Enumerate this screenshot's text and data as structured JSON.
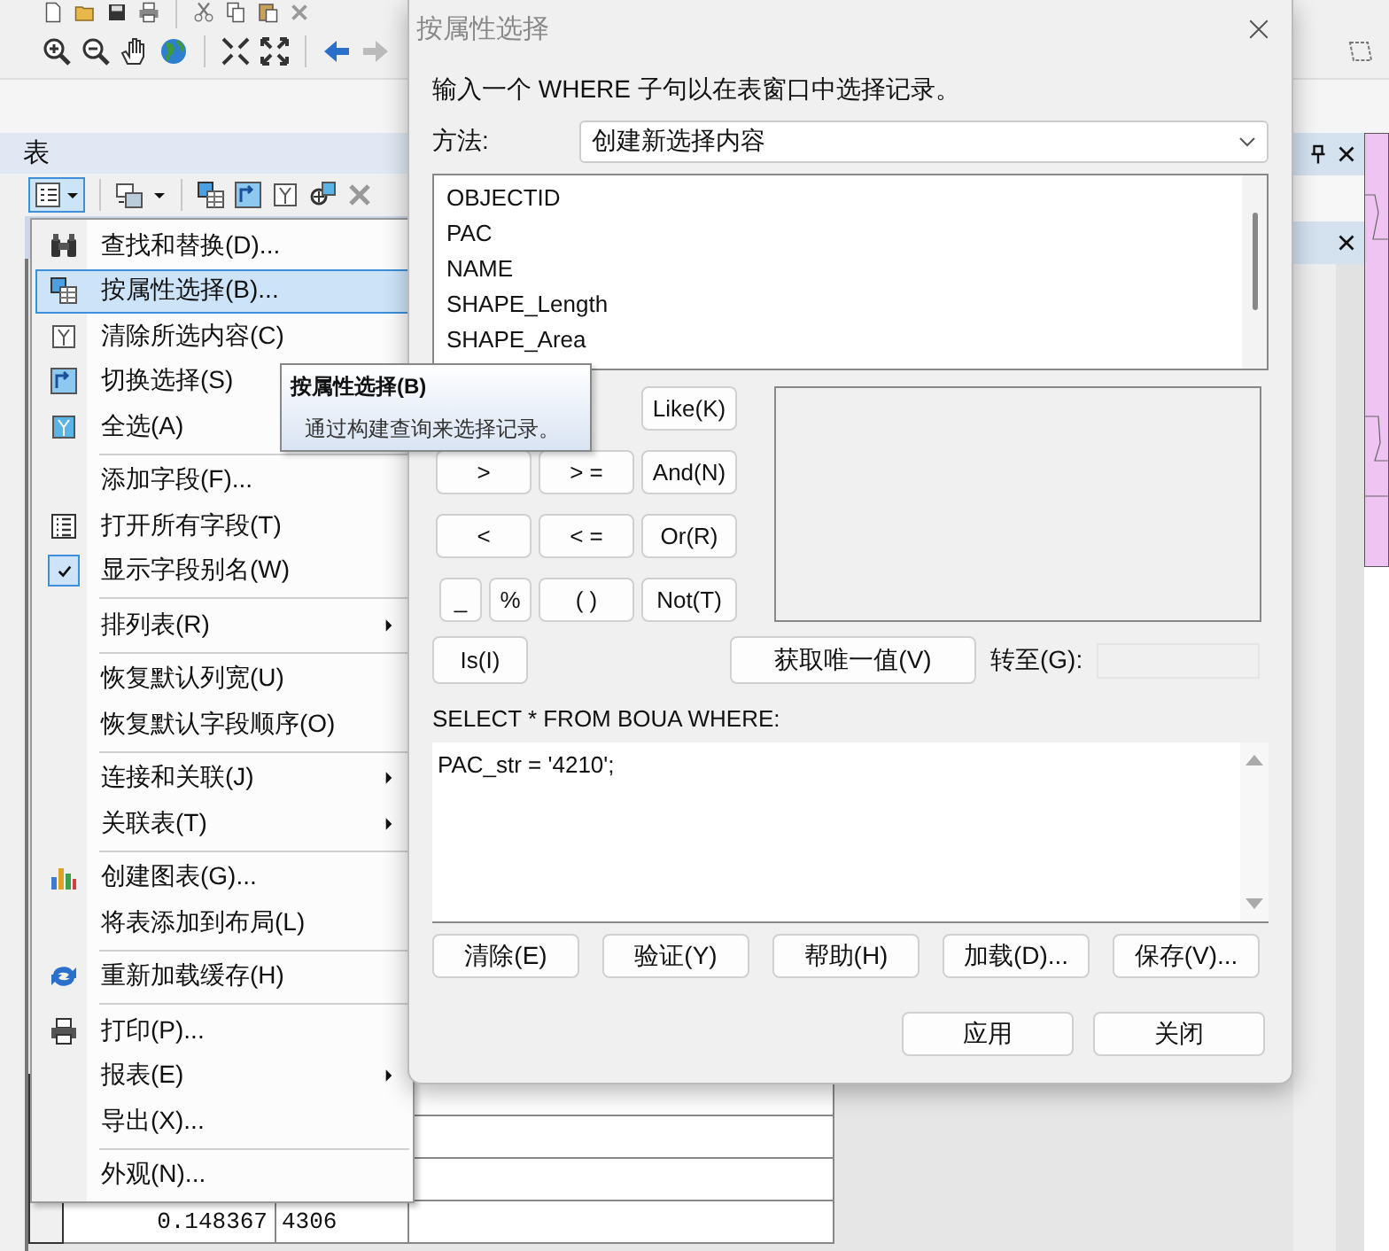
{
  "panel": {
    "title": "表"
  },
  "menu": {
    "items": [
      {
        "kind": "item",
        "label": "查找和替换(D)...",
        "selected": false,
        "checked": false,
        "submenu": false
      },
      {
        "kind": "item",
        "label": "按属性选择(B)...",
        "selected": true,
        "checked": false,
        "submenu": false
      },
      {
        "kind": "item",
        "label": "清除所选内容(C)",
        "selected": false,
        "checked": false,
        "submenu": false
      },
      {
        "kind": "item",
        "label": "切换选择(S)",
        "selected": false,
        "checked": false,
        "submenu": false
      },
      {
        "kind": "item",
        "label": "全选(A)",
        "selected": false,
        "checked": false,
        "submenu": false
      },
      {
        "kind": "separator"
      },
      {
        "kind": "item",
        "label": "添加字段(F)...",
        "selected": false,
        "checked": false,
        "submenu": false
      },
      {
        "kind": "item",
        "label": "打开所有字段(T)",
        "selected": false,
        "checked": false,
        "submenu": false
      },
      {
        "kind": "item",
        "label": "显示字段别名(W)",
        "selected": false,
        "checked": true,
        "submenu": false
      },
      {
        "kind": "separator"
      },
      {
        "kind": "item",
        "label": "排列表(R)",
        "selected": false,
        "checked": false,
        "submenu": true
      },
      {
        "kind": "separator"
      },
      {
        "kind": "item",
        "label": "恢复默认列宽(U)",
        "selected": false,
        "checked": false,
        "submenu": false
      },
      {
        "kind": "item",
        "label": "恢复默认字段顺序(O)",
        "selected": false,
        "checked": false,
        "submenu": false
      },
      {
        "kind": "separator"
      },
      {
        "kind": "item",
        "label": "连接和关联(J)",
        "selected": false,
        "checked": false,
        "submenu": true
      },
      {
        "kind": "item",
        "label": "关联表(T)",
        "selected": false,
        "checked": false,
        "submenu": true
      },
      {
        "kind": "separator"
      },
      {
        "kind": "item",
        "label": "创建图表(G)...",
        "selected": false,
        "checked": false,
        "submenu": false
      },
      {
        "kind": "item",
        "label": "将表添加到布局(L)",
        "selected": false,
        "checked": false,
        "submenu": false
      },
      {
        "kind": "separator"
      },
      {
        "kind": "item",
        "label": "重新加载缓存(H)",
        "selected": false,
        "checked": false,
        "submenu": false
      },
      {
        "kind": "separator"
      },
      {
        "kind": "item",
        "label": "打印(P)...",
        "selected": false,
        "checked": false,
        "submenu": false
      },
      {
        "kind": "item",
        "label": "报表(E)",
        "selected": false,
        "checked": false,
        "submenu": true
      },
      {
        "kind": "item",
        "label": "导出(X)...",
        "selected": false,
        "checked": false,
        "submenu": false
      },
      {
        "kind": "separator"
      },
      {
        "kind": "item",
        "label": "外观(N)...",
        "selected": false,
        "checked": false,
        "submenu": false
      }
    ]
  },
  "tooltip": {
    "title": "按属性选择(B)",
    "text": "通过构建查询来选择记录。"
  },
  "table": {
    "rows": [
      {
        "cells": [
          "0.148367",
          "4306"
        ]
      }
    ]
  },
  "dialog": {
    "title": "按属性选择",
    "prompt": "输入一个 WHERE 子句以在表窗口中选择记录。",
    "method_label": "方法:",
    "method_value": "创建新选择内容",
    "fields": [
      "OBJECTID",
      "PAC",
      "NAME",
      "SHAPE_Length",
      "SHAPE_Area"
    ],
    "operators": [
      [
        {
          "label": "Like(K)",
          "kind": "wide"
        }
      ],
      [
        {
          "label": ">",
          "kind": "wide"
        },
        {
          "label": "> =",
          "kind": "wide"
        },
        {
          "label": "And(N)",
          "kind": "wide"
        }
      ],
      [
        {
          "label": "<",
          "kind": "wide"
        },
        {
          "label": "< =",
          "kind": "wide"
        },
        {
          "label": "Or(R)",
          "kind": "wide"
        }
      ],
      [
        {
          "label": "_",
          "kind": "narrow"
        },
        {
          "label": "%",
          "kind": "narrow"
        },
        {
          "label": "( )",
          "kind": "wide"
        },
        {
          "label": "Not(T)",
          "kind": "wide"
        }
      ]
    ],
    "is_button": "Is(I)",
    "unique_button": "获取唯一值(V)",
    "goto_label": "转至(G):",
    "sql_label": "SELECT * FROM BOUA WHERE:",
    "expression": "PAC_str = '4210';",
    "actions": [
      "清除(E)",
      "验证(Y)",
      "帮助(H)",
      "加载(D)...",
      "保存(V)..."
    ],
    "footer_buttons": [
      "应用",
      "关闭"
    ]
  }
}
